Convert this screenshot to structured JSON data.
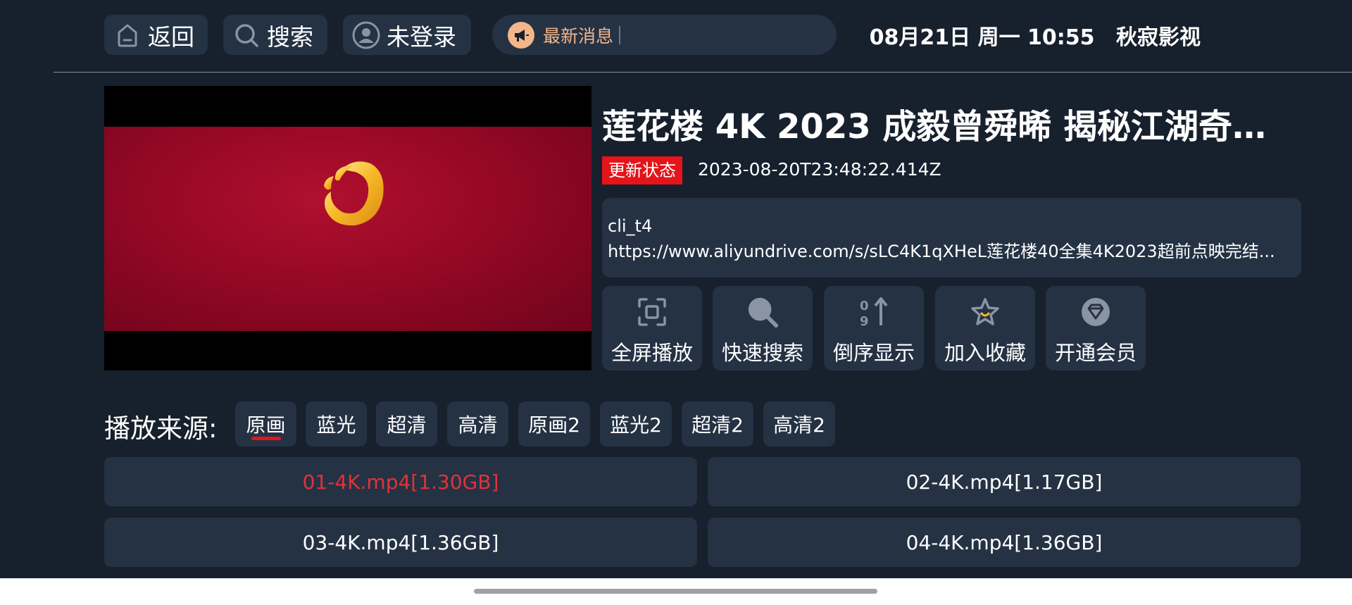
{
  "topbar": {
    "back_label": "返回",
    "search_label": "搜索",
    "login_label": "未登录",
    "news_label": "最新消息",
    "datetime": "08月21日 周一 10:55",
    "app_name": "秋寂影视"
  },
  "detail": {
    "title": "莲花楼 4K 2023 成毅曾舜晞 揭秘江湖奇案...",
    "status_badge": "更新状态",
    "update_time": "2023-08-20T23:48:22.414Z",
    "desc_line1": "cli_t4",
    "desc_line2": "https://www.aliyundrive.com/s/sLC4K1qXHeL莲花楼40全集4K2023超前点映完结..."
  },
  "actions": [
    {
      "label": "全屏播放",
      "icon": "fullscreen-icon"
    },
    {
      "label": "快速搜索",
      "icon": "magnifier-icon"
    },
    {
      "label": "倒序显示",
      "icon": "sort-reverse-icon"
    },
    {
      "label": "加入收藏",
      "icon": "star-icon"
    },
    {
      "label": "开通会员",
      "icon": "diamond-icon"
    }
  ],
  "sources": {
    "label": "播放来源:",
    "tabs": [
      "原画",
      "蓝光",
      "超清",
      "高清",
      "原画2",
      "蓝光2",
      "超清2",
      "高清2"
    ],
    "selected": "原画"
  },
  "episodes": [
    {
      "label": "01-4K.mp4[1.30GB]",
      "active": true
    },
    {
      "label": "02-4K.mp4[1.17GB]",
      "active": false
    },
    {
      "label": "03-4K.mp4[1.36GB]",
      "active": false
    },
    {
      "label": "04-4K.mp4[1.36GB]",
      "active": false
    }
  ],
  "colors": {
    "background": "#17202d",
    "panel": "#243244",
    "accent_red": "#e4141b",
    "news_orange": "#f4b58a"
  }
}
